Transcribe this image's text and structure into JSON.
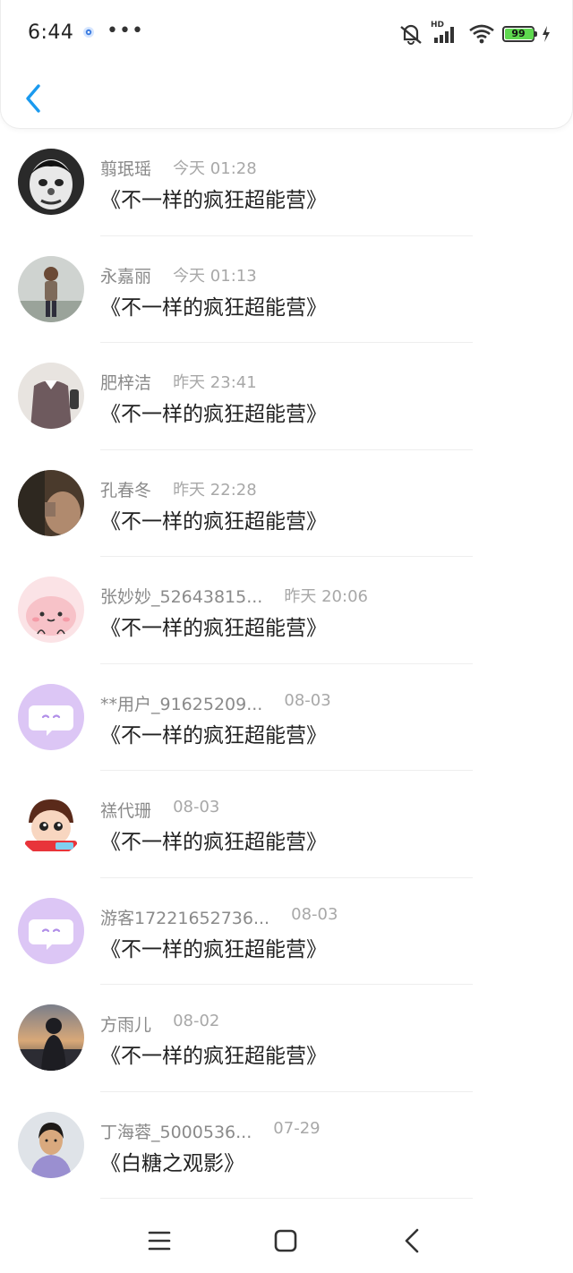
{
  "status_bar": {
    "time": "6:44",
    "battery_level": "99",
    "battery_fraction": 0.99,
    "network_label": "HD",
    "more_glyph": "•••"
  },
  "header": {
    "back_icon": "chevron-left-icon",
    "accent_color": "#1a9aef"
  },
  "list": [
    {
      "name": "翦珉瑶",
      "time": "今天 01:28",
      "title": "《不一样的疯狂超能营》",
      "avatar": "clown-avatar"
    },
    {
      "name": "永嘉丽",
      "time": "今天 01:13",
      "title": "《不一样的疯狂超能营》",
      "avatar": "person-avatar"
    },
    {
      "name": "肥梓洁",
      "time": "昨天 23:41",
      "title": "《不一样的疯狂超能营》",
      "avatar": "outfit-avatar"
    },
    {
      "name": "孔春冬",
      "time": "昨天 22:28",
      "title": "《不一样的疯狂超能营》",
      "avatar": "dark-photo-avatar"
    },
    {
      "name": "张妙妙_52643815...",
      "time": "昨天 20:06",
      "title": "《不一样的疯狂超能营》",
      "avatar": "pink-blob-avatar"
    },
    {
      "name": "**用户_91625209...",
      "time": "08-03",
      "title": "《不一样的疯狂超能营》",
      "avatar": "default-chat-avatar"
    },
    {
      "name": "禚代珊",
      "time": "08-03",
      "title": "《不一样的疯狂超能营》",
      "avatar": "cartoon-avatar"
    },
    {
      "name": "游客17221652736...",
      "time": "08-03",
      "title": "《不一样的疯狂超能营》",
      "avatar": "default-chat-avatar"
    },
    {
      "name": "方雨儿",
      "time": "08-02",
      "title": "《不一样的疯狂超能营》",
      "avatar": "sunset-silhouette-avatar"
    },
    {
      "name": "丁海蓉_5000536...",
      "time": "07-29",
      "title": "《白糖之观影》",
      "avatar": "portrait-avatar"
    }
  ],
  "nav": {
    "menu_icon": "menu-icon",
    "home_icon": "home-square-icon",
    "back_icon": "back-triangle-icon"
  }
}
